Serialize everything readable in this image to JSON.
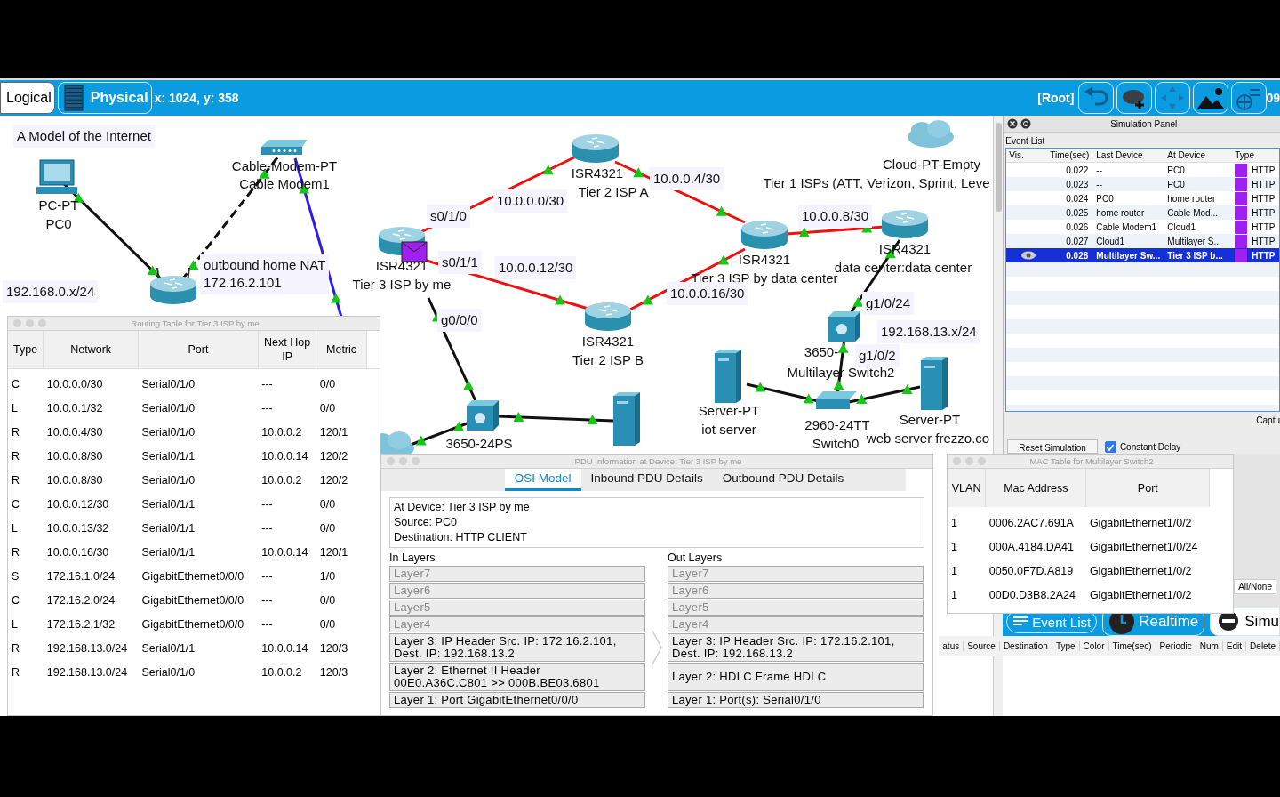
{
  "toolbar": {
    "tabs": [
      {
        "label": "Logical",
        "selected": true
      },
      {
        "label": "Physical",
        "selected": false
      }
    ],
    "coords": "x: 1024, y: 358",
    "path": "[Root]",
    "cut_text": "09"
  },
  "canvas": {
    "notes": [
      {
        "lines": [
          "A Model of the Internet"
        ]
      },
      {
        "lines": [
          "192.168.0.x/24"
        ]
      },
      {
        "lines": [
          "outbound home NAT",
          "172.16.2.101"
        ]
      },
      {
        "lines": [
          "s0/1/0"
        ]
      },
      {
        "lines": [
          "10.0.0.0/30"
        ]
      },
      {
        "lines": [
          "s0/1/1"
        ]
      },
      {
        "lines": [
          "10.0.0.12/30"
        ]
      },
      {
        "lines": [
          "g0/0/0"
        ]
      },
      {
        "lines": [
          "10.0.0.4/30"
        ]
      },
      {
        "lines": [
          "10.0.0.8/30"
        ]
      },
      {
        "lines": [
          "10.0.0.16/30"
        ]
      },
      {
        "lines": [
          "g1/0/24"
        ]
      },
      {
        "lines": [
          "192.168.13.x/24"
        ]
      },
      {
        "lines": [
          "g1/0/2"
        ]
      }
    ],
    "devices": [
      {
        "kind": "pc",
        "labels": [
          "PC-PT",
          "PC0"
        ]
      },
      {
        "kind": "modem",
        "labels": [
          "Cable-Modem-PT",
          "Cable Modem1"
        ]
      },
      {
        "kind": "wireless-router"
      },
      {
        "kind": "router",
        "labels": [
          "ISR4321",
          "Tier 3 ISP by me"
        ]
      },
      {
        "kind": "router",
        "labels": [
          "ISR4321",
          "Tier 2 ISP A"
        ]
      },
      {
        "kind": "router",
        "labels": [
          "ISR4321",
          "Tier 2 ISP B"
        ]
      },
      {
        "kind": "router",
        "labels": [
          "ISR4321",
          "Tier 3 ISP by data center"
        ]
      },
      {
        "kind": "router",
        "labels": [
          "ISR4321",
          "data center:data center"
        ]
      },
      {
        "kind": "multilayer-switch",
        "labels": [
          "3650-",
          "Multilayer Switch2"
        ]
      },
      {
        "kind": "switch",
        "labels": [
          "2960-24TT",
          "Switch0"
        ]
      },
      {
        "kind": "server",
        "labels": [
          "Server-PT",
          "iot server"
        ]
      },
      {
        "kind": "server",
        "labels": [
          "Server-PT",
          "web server frezzo.co"
        ]
      },
      {
        "kind": "multilayer-switch",
        "labels": [
          "3650-24PS"
        ]
      },
      {
        "kind": "server"
      },
      {
        "kind": "cloud",
        "labels": [
          "Cloud-PT-Empty",
          "Tier 1 ISPs (ATT, Verizon, Sprint, Leve"
        ]
      },
      {
        "kind": "cloud"
      }
    ]
  },
  "simulation_panel": {
    "title": "Simulation Panel",
    "event_list_label": "Event List",
    "columns": [
      "Vis.",
      "Time(sec)",
      "Last Device",
      "At Device",
      "Type"
    ],
    "events": [
      {
        "time": "0.022",
        "last_device": "--",
        "at_device": "PC0",
        "type": "HTTP",
        "color": "#a020f0",
        "selected": false
      },
      {
        "time": "0.023",
        "last_device": "--",
        "at_device": "PC0",
        "type": "HTTP",
        "color": "#a020f0",
        "selected": false
      },
      {
        "time": "0.024",
        "last_device": "PC0",
        "at_device": "home router",
        "type": "HTTP",
        "color": "#a020f0",
        "selected": false
      },
      {
        "time": "0.025",
        "last_device": "home router",
        "at_device": "Cable Mod...",
        "type": "HTTP",
        "color": "#a020f0",
        "selected": false
      },
      {
        "time": "0.026",
        "last_device": "Cable Modem1",
        "at_device": "Cloud1",
        "type": "HTTP",
        "color": "#a020f0",
        "selected": false
      },
      {
        "time": "0.027",
        "last_device": "Cloud1",
        "at_device": "Multilayer S...",
        "type": "HTTP",
        "color": "#a020f0",
        "selected": false
      },
      {
        "time": "0.028",
        "last_device": "Multilayer Sw...",
        "at_device": "Tier 3 ISP b...",
        "type": "HTTP",
        "color": "#a020f0",
        "selected": true
      }
    ],
    "reset_button": "Reset Simulation",
    "constant_delay": {
      "label": "Constant Delay",
      "checked": true
    },
    "cut_text": "Captu",
    "all_none": "All/None"
  },
  "bottom_bar": {
    "buttons": [
      {
        "kind": "event-list",
        "label": "Event List"
      },
      {
        "kind": "realtime",
        "label": "Realtime"
      },
      {
        "kind": "simulation",
        "label": "Simu"
      }
    ],
    "columns": [
      "atus",
      "Source",
      "Destination",
      "Type",
      "Color",
      "Time(sec)",
      "Periodic",
      "Num",
      "Edit",
      "Delete"
    ]
  },
  "routing_table": {
    "title": "Routing Table for Tier 3 ISP by me",
    "columns": [
      "Type",
      "Network",
      "Port",
      "Next Hop IP",
      "Metric"
    ],
    "rows": [
      {
        "type": "C",
        "network": "10.0.0.0/30",
        "port": "Serial0/1/0",
        "next_hop": "---",
        "metric": "0/0"
      },
      {
        "type": "L",
        "network": "10.0.0.1/32",
        "port": "Serial0/1/0",
        "next_hop": "---",
        "metric": "0/0"
      },
      {
        "type": "R",
        "network": "10.0.0.4/30",
        "port": "Serial0/1/0",
        "next_hop": "10.0.0.2",
        "metric": "120/1"
      },
      {
        "type": "R",
        "network": "10.0.0.8/30",
        "port": "Serial0/1/1",
        "next_hop": "10.0.0.14",
        "metric": "120/2"
      },
      {
        "type": "R",
        "network": "10.0.0.8/30",
        "port": "Serial0/1/0",
        "next_hop": "10.0.0.2",
        "metric": "120/2"
      },
      {
        "type": "C",
        "network": "10.0.0.12/30",
        "port": "Serial0/1/1",
        "next_hop": "---",
        "metric": "0/0"
      },
      {
        "type": "L",
        "network": "10.0.0.13/32",
        "port": "Serial0/1/1",
        "next_hop": "---",
        "metric": "0/0"
      },
      {
        "type": "R",
        "network": "10.0.0.16/30",
        "port": "Serial0/1/1",
        "next_hop": "10.0.0.14",
        "metric": "120/1"
      },
      {
        "type": "S",
        "network": "172.16.1.0/24",
        "port": "GigabitEthernet0/0/0",
        "next_hop": "---",
        "metric": "1/0"
      },
      {
        "type": "C",
        "network": "172.16.2.0/24",
        "port": "GigabitEthernet0/0/0",
        "next_hop": "---",
        "metric": "0/0"
      },
      {
        "type": "L",
        "network": "172.16.2.1/32",
        "port": "GigabitEthernet0/0/0",
        "next_hop": "---",
        "metric": "0/0"
      },
      {
        "type": "R",
        "network": "192.168.13.0/24",
        "port": "Serial0/1/1",
        "next_hop": "10.0.0.14",
        "metric": "120/3"
      },
      {
        "type": "R",
        "network": "192.168.13.0/24",
        "port": "Serial0/1/0",
        "next_hop": "10.0.0.2",
        "metric": "120/3"
      }
    ]
  },
  "pdu_window": {
    "title": "PDU Information at Device: Tier 3 ISP by me",
    "tabs": [
      {
        "label": "OSI Model",
        "selected": true
      },
      {
        "label": "Inbound PDU Details",
        "selected": false
      },
      {
        "label": "Outbound PDU Details",
        "selected": false
      }
    ],
    "info": [
      "At Device: Tier 3 ISP by me",
      "Source: PC0",
      "Destination: HTTP CLIENT"
    ],
    "in_label": "In Layers",
    "out_label": "Out Layers",
    "in_layers": [
      {
        "lines": [
          "Layer7"
        ],
        "disabled": true
      },
      {
        "lines": [
          "Layer6"
        ],
        "disabled": true
      },
      {
        "lines": [
          "Layer5"
        ],
        "disabled": true
      },
      {
        "lines": [
          "Layer4"
        ],
        "disabled": true
      },
      {
        "lines": [
          "Layer 3: IP Header Src. IP: 172.16.2.101,",
          "Dest. IP: 192.168.13.2"
        ],
        "disabled": false
      },
      {
        "lines": [
          "Layer 2: Ethernet II Header",
          "00E0.A36C.C801 >> 000B.BE03.6801"
        ],
        "disabled": false
      },
      {
        "lines": [
          "Layer 1: Port GigabitEthernet0/0/0"
        ],
        "disabled": false
      }
    ],
    "out_layers": [
      {
        "lines": [
          "Layer7"
        ],
        "disabled": true
      },
      {
        "lines": [
          "Layer6"
        ],
        "disabled": true
      },
      {
        "lines": [
          "Layer5"
        ],
        "disabled": true
      },
      {
        "lines": [
          "Layer4"
        ],
        "disabled": true
      },
      {
        "lines": [
          "Layer 3: IP Header Src. IP: 172.16.2.101,",
          "Dest. IP: 192.168.13.2"
        ],
        "disabled": false
      },
      {
        "lines": [
          "Layer 2: HDLC Frame HDLC"
        ],
        "disabled": false
      },
      {
        "lines": [
          "Layer 1: Port(s): Serial0/1/0"
        ],
        "disabled": false
      }
    ]
  },
  "mac_table": {
    "title": "MAC Table for Multilayer Switch2",
    "columns": [
      "VLAN",
      "Mac Address",
      "Port"
    ],
    "rows": [
      {
        "vlan": "1",
        "mac": "0006.2AC7.691A",
        "port": "GigabitEthernet1/0/2"
      },
      {
        "vlan": "1",
        "mac": "000A.4184.DA41",
        "port": "GigabitEthernet1/0/24"
      },
      {
        "vlan": "1",
        "mac": "0050.0F7D.A819",
        "port": "GigabitEthernet1/0/2"
      },
      {
        "vlan": "1",
        "mac": "00D0.D3B8.2A24",
        "port": "GigabitEthernet1/0/2"
      }
    ]
  }
}
